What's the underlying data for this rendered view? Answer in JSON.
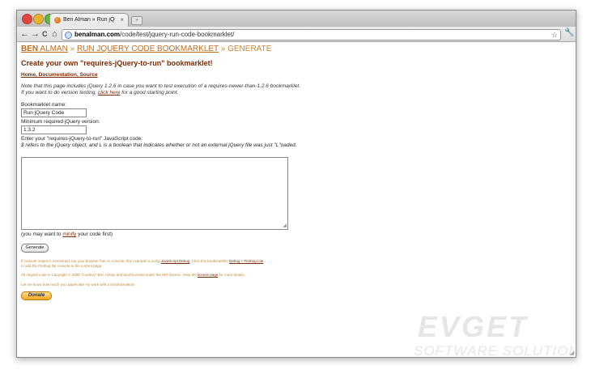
{
  "browser": {
    "tab_title": "Ben Alman » Run jQuery Cod",
    "tab_close": "×",
    "new_tab": "+",
    "back": "←",
    "forward": "→",
    "reload": "C",
    "home": "⌂",
    "url_domain": "benalman.com",
    "url_path": "/code/test/jquery-run-code-bookmarklet/",
    "star": "☆",
    "wrench": "🔧"
  },
  "breadcrumb": {
    "ben": "BEN",
    "alman": " ALMAN",
    "sep1": "»",
    "run": "RUN JQUERY CODE BOOKMARKLET",
    "sep2": "»",
    "generate": "GENERATE"
  },
  "page": {
    "title": "Create your own \"requires-jQuery-to-run\" bookmarklet!",
    "home_link": "Home, Documentation, Source",
    "note_line1": "Note that this page includes jQuery 1.2.6 in case you want to test execution of a requires-newer-than-1.2.6 bookmarklet.",
    "note_line2_pre": "If you want to do version testing, ",
    "note_line2_link": "click here",
    "note_line2_post": " for a good starting point.",
    "name_label": "Bookmarklet name:",
    "name_value": "Run jQuery Code",
    "version_label": "Minimum required jQuery version:",
    "version_value": "1.3.2",
    "code_label": "Enter your \"requires-jQuery-to-run\" JavaScript code:",
    "code_note": "$ refers to the jQuery object, and L is a boolean that indicates whether or not an external jQuery file was just \"L\"oaded.",
    "resize_grip": "◢",
    "hint_pre": "(you may want to ",
    "hint_link": "minify",
    "hint_post": " your code first)",
    "generate_button": "Generate",
    "footer1_pre": "If console output is mentioned, but your browser has no console, this example is using ",
    "footer1_link1": "JavaScript Debug",
    "footer1_mid": ". Click this bookmarklet: ",
    "footer1_link2": "Debug + Firebug Lite",
    "footer1_line2": "to add the Firebug lite console to the current page.",
    "footer2_pre": "All original code is Copyright © 2009 \"Cowboy\" Ben Alman and dual licensed under the MIT license. View the ",
    "footer2_link": "license page",
    "footer2_post": " for more details.",
    "footer3": "Let me know how much you appreciate my work with a small donation!",
    "donate_button": "Donate"
  },
  "watermark": {
    "line1": "EVGET",
    "line2": "SOFTWARE SOLUTIONS"
  },
  "colors": {
    "accent": "#c06b1a",
    "heading": "#7a2a00"
  }
}
